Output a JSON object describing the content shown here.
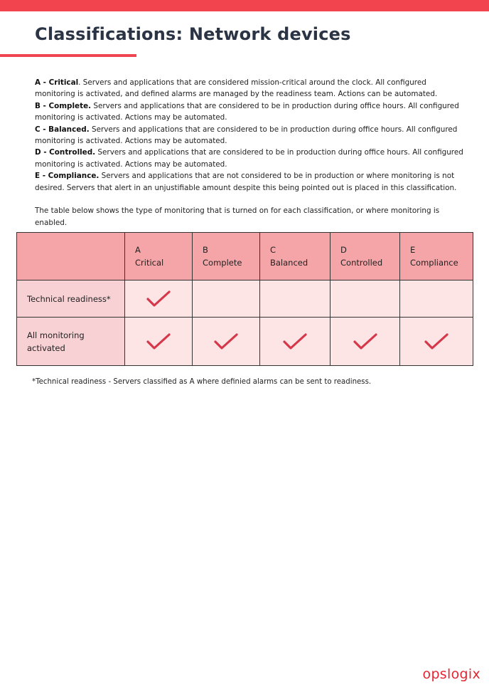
{
  "header": {
    "title": "Classifications: Network devices",
    "accent_color": "#f2444f"
  },
  "definitions": [
    {
      "term": "A - Critical",
      "text": ". Servers and applications that are considered mission-critical around the clock. All configured monitoring is activated, and defined alarms are managed by the readiness team. Actions can be automated."
    },
    {
      "term": "B - Complete.",
      "text": " Servers and applications that are considered to be in production during office hours. All configured monitoring is activated. Actions may be automated."
    },
    {
      "term": "C - Balanced.",
      "text": " Servers and applications that are considered to be in production during office hours.  All configured monitoring is activated. Actions may be automated."
    },
    {
      "term": "D - Controlled.",
      "text": " Servers and applications that are considered to be in production during office hours.  All configured monitoring is activated. Actions may be automated."
    },
    {
      "term": "E - Compliance.",
      "text": " Servers and applications that are not considered to be in production or where monitoring is not desired. Servers that alert in an unjustifiable amount despite this being pointed out is placed in this classification."
    }
  ],
  "intro": "The table below shows the type of monitoring that is turned on for each classification, or where monitoring is enabled.",
  "table": {
    "columns": [
      {
        "letter": "A",
        "name": "Critical"
      },
      {
        "letter": "B",
        "name": "Complete"
      },
      {
        "letter": "C",
        "name": "Balanced"
      },
      {
        "letter": "D",
        "name": "Controlled"
      },
      {
        "letter": "E",
        "name": "Compliance"
      }
    ],
    "rows": [
      {
        "label": "Technical readiness*",
        "checks": [
          true,
          false,
          false,
          false,
          false
        ]
      },
      {
        "label": "All monitoring activated",
        "checks": [
          true,
          true,
          true,
          true,
          true
        ]
      }
    ],
    "check_icon": "checkmark-icon",
    "check_color": "#d4384a"
  },
  "footnote": "*Technical readiness - Servers classified as A where definied alarms can be sent to readiness.",
  "logo": "opslogix"
}
